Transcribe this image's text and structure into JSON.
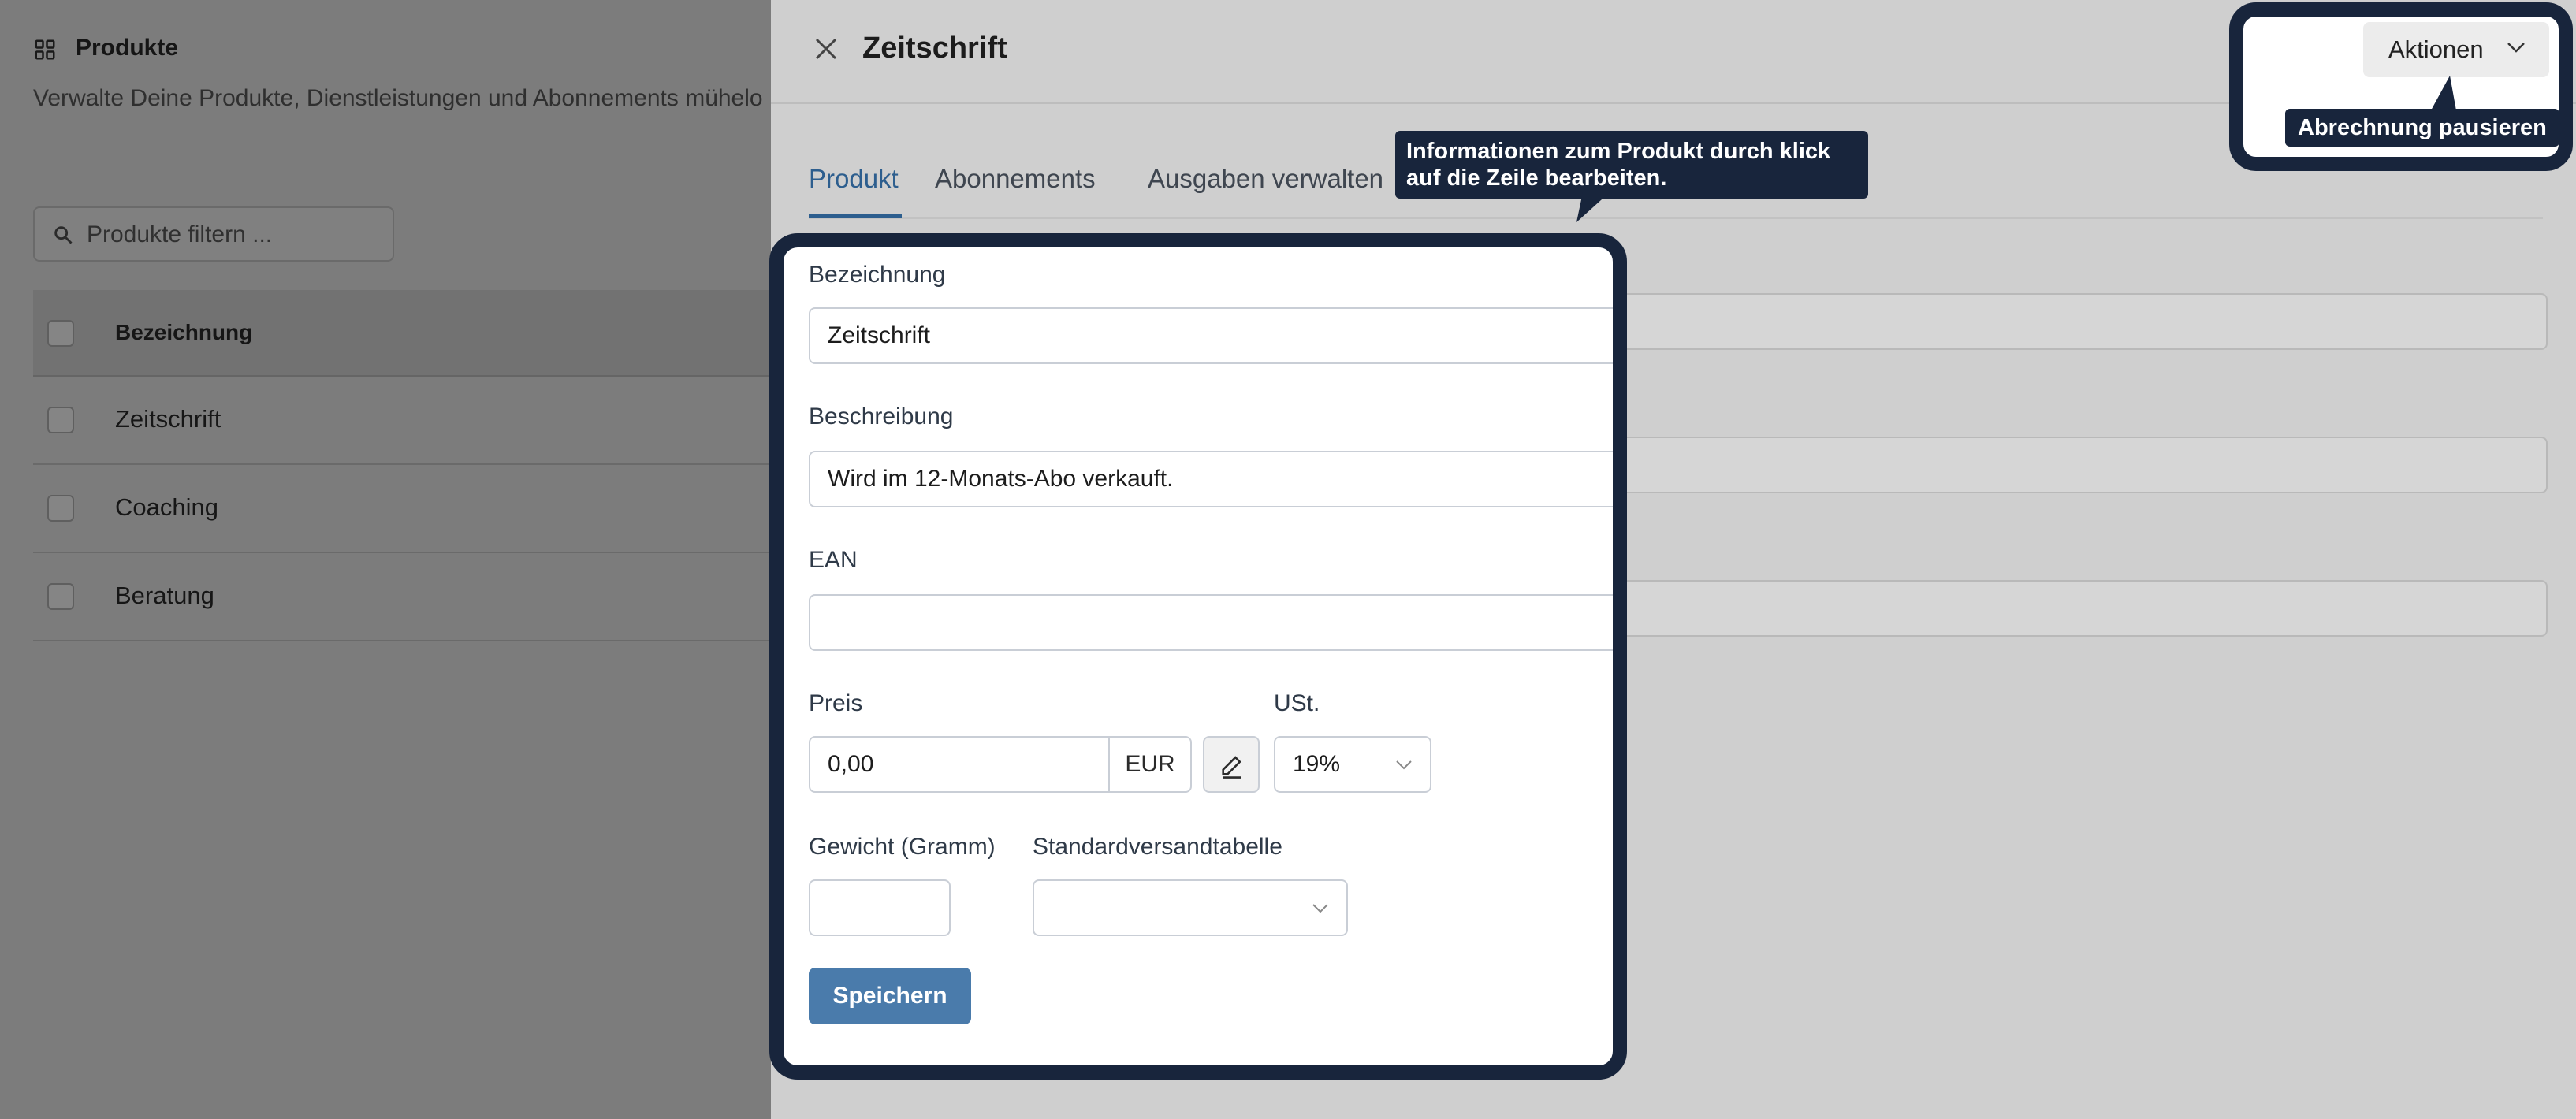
{
  "background": {
    "title": "Produkte",
    "subtitle": "Verwalte Deine Produkte, Dienstleistungen und Abonnements mühelo",
    "filter_placeholder": "Produkte filtern ...",
    "table_header": "Bezeichnung",
    "rows": [
      "Zeitschrift",
      "Coaching",
      "Beratung"
    ]
  },
  "panel": {
    "title": "Zeitschrift",
    "actions_label": "Aktionen",
    "tabs": [
      "Produkt",
      "Abonnements",
      "Ausgaben verwalten"
    ],
    "active_tab": "Produkt"
  },
  "tooltips": {
    "actions": "Abrechnung pausieren",
    "tabs": "Informationen zum Produkt durch klick auf die Zeile bearbeiten."
  },
  "form": {
    "name_label": "Bezeichnung",
    "name_value": "Zeitschrift",
    "description_label": "Beschreibung",
    "description_value": "Wird im 12-Monats-Abo verkauft.",
    "ean_label": "EAN",
    "ean_value": "",
    "price_label": "Preis",
    "price_value": "0,00",
    "currency": "EUR",
    "vat_label": "USt.",
    "vat_value": "19%",
    "weight_label": "Gewicht (Gramm)",
    "weight_value": "",
    "shipping_label": "Standardversandtabelle",
    "shipping_value": "",
    "save_label": "Speichern"
  },
  "colors": {
    "accent": "#4a7bab",
    "tab_active": "#2d5e8e",
    "highlight": "#18253c"
  }
}
